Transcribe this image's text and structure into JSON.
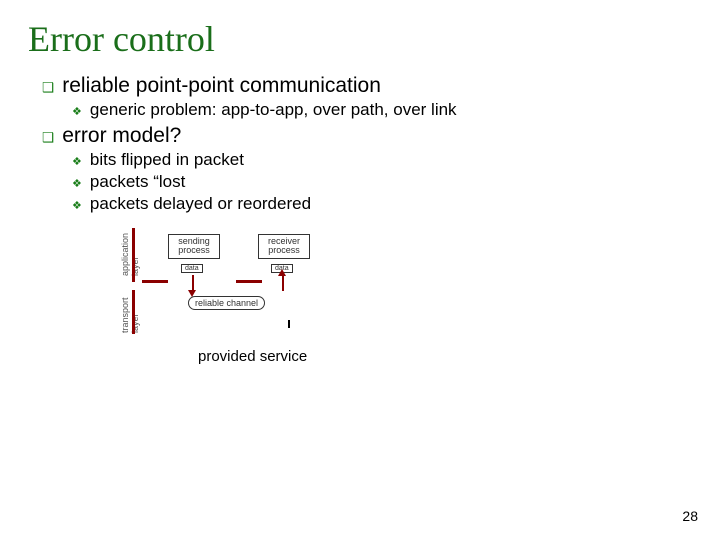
{
  "title": "Error control",
  "bullets": {
    "b1": "reliable point-point communication",
    "b1a": "generic problem: app-to-app, over path, over link",
    "b2": "error model?",
    "b2a": "bits flipped in packet",
    "b2b": "packets “lost",
    "b2c": "packets delayed or reordered"
  },
  "diagram": {
    "app_layer": "application\nlayer",
    "trans_layer": "transport\nlayer",
    "send_proc": "sending\nprocess",
    "recv_proc": "receiver\nprocess",
    "data": "data",
    "channel": "reliable channel"
  },
  "caption": "provided service",
  "page_number": "28"
}
